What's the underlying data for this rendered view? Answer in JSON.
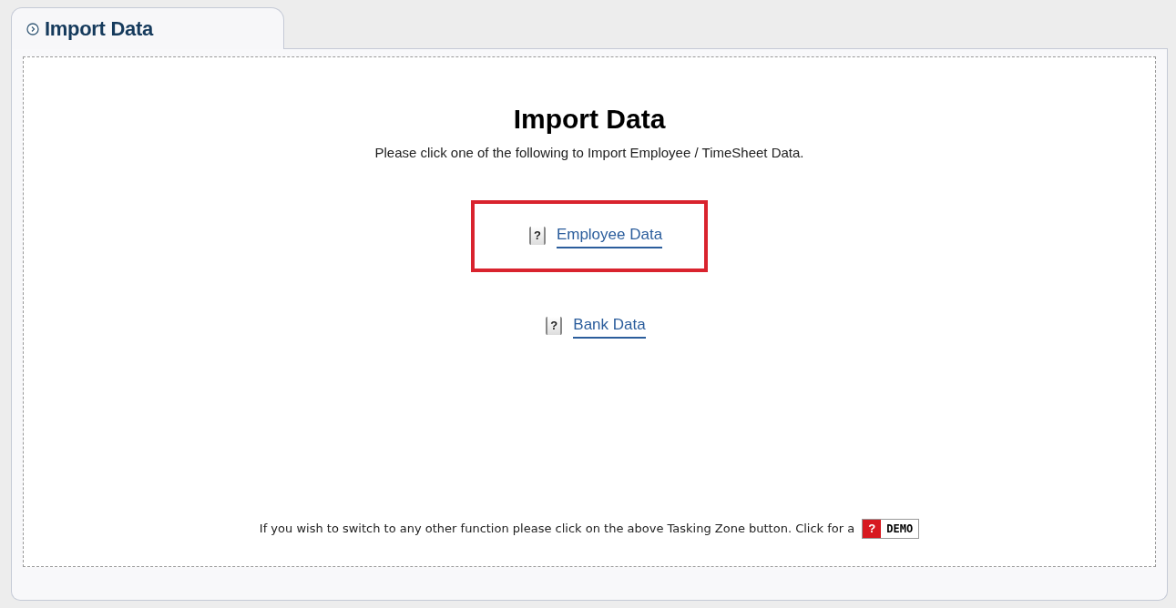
{
  "tab": {
    "title": "Import Data"
  },
  "heading": "Import Data",
  "instruction": "Please click one of the following to Import Employee / TimeSheet Data.",
  "links": [
    {
      "help": "?",
      "label": "Employee Data",
      "highlighted": true
    },
    {
      "help": "?",
      "label": "Bank Data",
      "highlighted": false
    }
  ],
  "footer": {
    "text": "If you wish to switch to any other function please click on the above Tasking Zone button. Click for a",
    "demo_mark": "?",
    "demo_label": "DEMO"
  }
}
